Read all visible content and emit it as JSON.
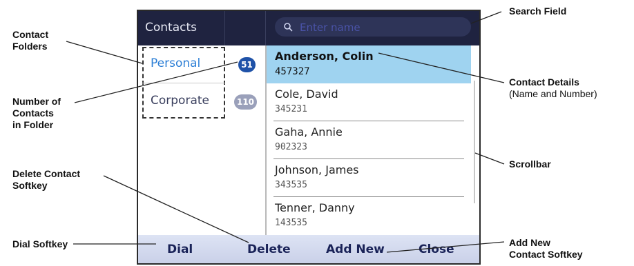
{
  "screen": {
    "title": "Contacts",
    "search": {
      "placeholder": "Enter name",
      "value": ""
    },
    "folders": [
      {
        "name": "Personal",
        "count": "51",
        "selected": true
      },
      {
        "name": "Corporate",
        "count": "110",
        "selected": false
      }
    ],
    "contacts": [
      {
        "name": "Anderson, Colin",
        "number": "457327",
        "selected": true
      },
      {
        "name": "Cole, David",
        "number": "345231",
        "selected": false
      },
      {
        "name": "Gaha, Annie",
        "number": "902323",
        "selected": false
      },
      {
        "name": "Johnson, James",
        "number": "343535",
        "selected": false
      },
      {
        "name": "Tenner, Danny",
        "number": "143535",
        "selected": false
      }
    ],
    "softkeys": [
      "Dial",
      "Delete",
      "Add New",
      "Close"
    ]
  },
  "callouts": {
    "search_field": "Search Field",
    "contact_folders": [
      "Contact",
      "Folders"
    ],
    "number_of_contacts": [
      "Number of",
      "Contacts",
      "in Folder"
    ],
    "contact_details": {
      "title": "Contact Details",
      "sub": "(Name and Number)"
    },
    "scrollbar": "Scrollbar",
    "delete_softkey": [
      "Delete Contact",
      "Softkey"
    ],
    "dial_softkey": "Dial Softkey",
    "add_new_softkey": [
      "Add New",
      "Contact Softkey"
    ]
  },
  "colors": {
    "header_bg": "#1f2340",
    "selected_row": "#9fd3f0",
    "badge_personal": "#1f52a8",
    "badge_corporate": "#9aa0ba",
    "softkey_text": "#1a2358"
  }
}
